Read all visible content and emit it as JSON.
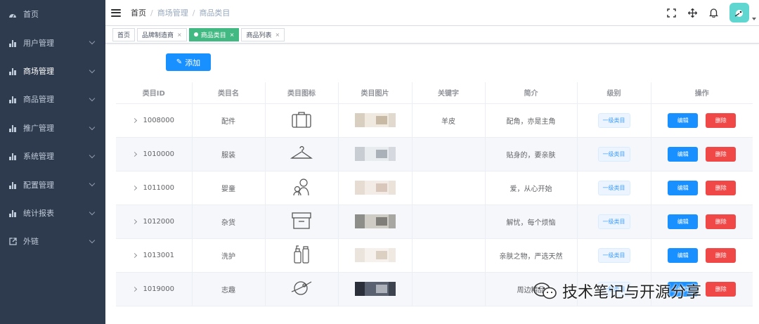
{
  "sidebar": {
    "items": [
      {
        "label": "首页",
        "icon": "dashboard-icon",
        "expandable": false
      },
      {
        "label": "用户管理",
        "icon": "chart-icon",
        "expandable": true
      },
      {
        "label": "商场管理",
        "icon": "chart-icon",
        "expandable": true,
        "active": true
      },
      {
        "label": "商品管理",
        "icon": "chart-icon",
        "expandable": true
      },
      {
        "label": "推广管理",
        "icon": "chart-icon",
        "expandable": true
      },
      {
        "label": "系统管理",
        "icon": "chart-icon",
        "expandable": true
      },
      {
        "label": "配置管理",
        "icon": "chart-icon",
        "expandable": true
      },
      {
        "label": "统计报表",
        "icon": "chart-icon",
        "expandable": true
      },
      {
        "label": "外链",
        "icon": "external-link-icon",
        "expandable": true
      }
    ]
  },
  "header": {
    "breadcrumb": [
      "首页",
      "商场管理",
      "商品类目"
    ],
    "icons": [
      "fullscreen-icon",
      "size-icon",
      "bell-icon"
    ]
  },
  "tags": [
    {
      "label": "首页",
      "closable": false,
      "active": false
    },
    {
      "label": "品牌制造商",
      "closable": true,
      "active": false
    },
    {
      "label": "商品类目",
      "closable": true,
      "active": true
    },
    {
      "label": "商品列表",
      "closable": true,
      "active": false
    }
  ],
  "toolbar": {
    "add_label": "添加"
  },
  "table": {
    "columns": [
      "类目ID",
      "类目名",
      "类目图标",
      "类目图片",
      "关键字",
      "简介",
      "级别",
      "操作"
    ],
    "edit_label": "编辑",
    "delete_label": "删除",
    "rows": [
      {
        "id": "1008000",
        "name": "配件",
        "icon": "suitcase-icon",
        "keyword": "羊皮",
        "desc": "配角，亦是主角",
        "level": "一级类目"
      },
      {
        "id": "1010000",
        "name": "服装",
        "icon": "hanger-icon",
        "keyword": "",
        "desc": "贴身的，要亲肤",
        "level": "一级类目"
      },
      {
        "id": "1011000",
        "name": "婴童",
        "icon": "mother-child-icon",
        "keyword": "",
        "desc": "爱，从心开始",
        "level": "一级类目"
      },
      {
        "id": "1012000",
        "name": "杂货",
        "icon": "storage-box-icon",
        "keyword": "",
        "desc": "解忧，每个烦恼",
        "level": "一级类目"
      },
      {
        "id": "1013001",
        "name": "洗护",
        "icon": "toiletries-icon",
        "keyword": "",
        "desc": "亲肤之物，严选天然",
        "level": "一级类目"
      },
      {
        "id": "1019000",
        "name": "志趣",
        "icon": "planet-icon",
        "keyword": "",
        "desc": "周边精品",
        "level": "一级类目"
      }
    ]
  },
  "watermark": {
    "text": "技术笔记与开源分享"
  }
}
